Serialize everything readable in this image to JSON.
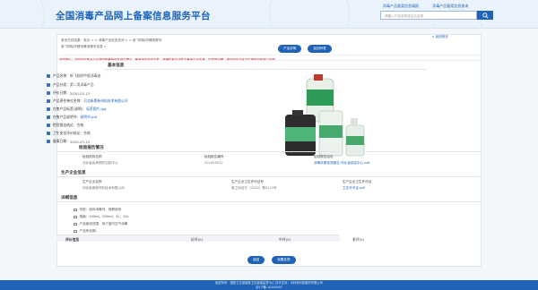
{
  "header": {
    "title": "全国消毒产品网上备案信息服务平台",
    "links": [
      "消毒产品备案信息填报",
      "消毒产品备案信息查询"
    ],
    "search_placeholder": "请输入产品名称或企业名称"
  },
  "breadcrumb": "首页在线结果：首页 > > 消毒产品信息查询 > > 新飞翔除甲醛喷雾剂",
  "breadcrumb2": "新飞翔除甲醛消毒液基本信息 >",
  "buttons": {
    "top": [
      "产品说明",
      "返回列表"
    ],
    "bottom": [
      "返回",
      "我要反馈"
    ]
  },
  "home_link": "返回首页",
  "notice": "风险提示：本网站仅基于企业提供的备案信息进行展示，备案信息的真实性、准确性和合法性由备案企业负责，如发现问题，请及时向当地卫生健康行政部门反映。",
  "basic": {
    "title": "基本信息",
    "rows": [
      {
        "k": "产品名称：",
        "v": "新飞翔除甲醛消毒液",
        "link": false
      },
      {
        "k": "产品分类：",
        "v": "第二类消毒产品",
        "link": false
      },
      {
        "k": "评价日期：",
        "v": "2020-03-13",
        "link": false
      },
      {
        "k": "产品责任单位名称：",
        "v": "河北新奥新材料技术有限公司",
        "link": true
      },
      {
        "k": "在售产品标签(说明)：",
        "v": "标签图片.jpg",
        "link": true
      },
      {
        "k": "在售产品说明书：",
        "v": "说明书.pdf",
        "link": true
      },
      {
        "k": "检验报告结论：",
        "v": "合格",
        "link": false
      },
      {
        "k": "卫生安全评价结论：",
        "v": "合格",
        "link": false
      },
      {
        "k": "备案日期：",
        "v": "2020-03-13",
        "link": false
      }
    ]
  },
  "report": {
    "title": "检验报告情况",
    "heads": [
      "检验机构名称",
      "检验报告编号",
      "检验报告结论"
    ],
    "values": [
      "河北省疾病预防控制中心",
      "20LH09012",
      "消毒效果检测报告-河北省疾控中心.pdf"
    ]
  },
  "company": {
    "title": "生产企业信息",
    "heads": [
      "生产企业名称",
      "生产企业卫生许可证号",
      "生产企业卫生许可证"
    ],
    "values": [
      "河北新奥新材料技术有限公司",
      "冀卫消证字（2020）第0115号",
      "卫生许可证.pdf"
    ]
  },
  "detail": {
    "title": "详细信息",
    "rows": [
      "剂型：液体消毒剂，喷雾使用",
      "规格：100ml、500ml、4L、10L",
      "产品使用范围：用于室内空气消毒",
      "产品有效期：-"
    ]
  },
  "evaluation": {
    "title": "评价信息",
    "labels": [
      "好评(0)",
      "中评(0)",
      "差评(0)"
    ]
  },
  "footer": {
    "line1": "版权所有：国家卫生健康委卫生健康监督中心  技术支持：中科软科技股份有限公司",
    "line2": "京ICP备 10263007"
  },
  "colors": {
    "primary": "#1e63b5",
    "notice": "#cc0000"
  }
}
